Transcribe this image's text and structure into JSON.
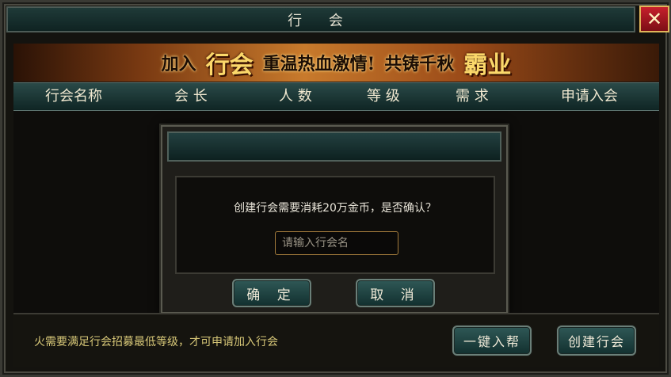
{
  "window": {
    "title": "行 会",
    "close_icon_glyph": "✕"
  },
  "banner": {
    "part1": "加入",
    "part2": "行会",
    "part3": "重温热血激情!",
    "part4": "共铸千秋",
    "part5": "霸业"
  },
  "headers": [
    "行会名称",
    "会 长",
    "人 数",
    "等 级",
    "需 求",
    "申请入会"
  ],
  "dialog": {
    "message": "创建行会需要消耗20万金币，是否确认？",
    "input_placeholder": "请输入行会名",
    "input_value": "",
    "confirm_label": "确 定",
    "cancel_label": "取 消"
  },
  "footer": {
    "notice": "火需要满足行会招募最低等级，才可申请加入行会",
    "join_label": "一键入帮",
    "create_label": "创建行会"
  },
  "colors": {
    "accent_teal": "#2f5856",
    "close_red": "#c6202c",
    "notice_yellow": "#d8c878"
  }
}
